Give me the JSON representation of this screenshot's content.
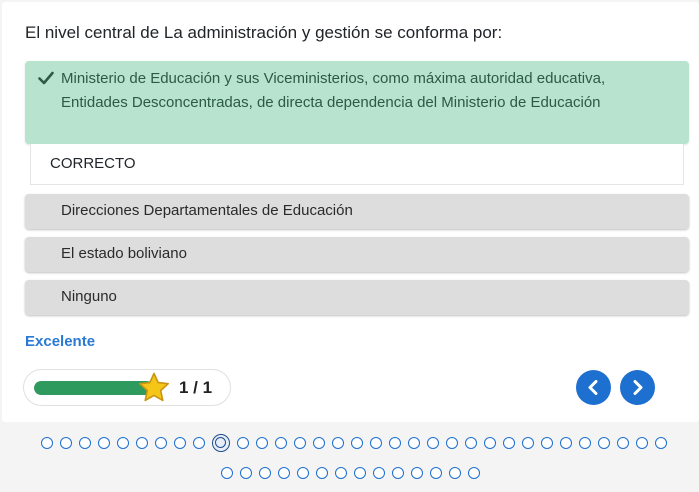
{
  "question": {
    "text": "El nivel central de La administración y gestión se conforma por:"
  },
  "answers": {
    "selected": "Ministerio de Educación y sus Viceministerios, como máxima autoridad educativa, Entidades Desconcentradas, de directa dependencia del Ministerio de Educación",
    "feedback": "CORRECTO",
    "options": [
      "Direcciones Departamentales de Educación",
      "El estado boliviano",
      "Ninguno"
    ]
  },
  "result": {
    "label": "Excelente"
  },
  "progress": {
    "count_label": "1 / 1",
    "fraction": 1.0
  },
  "pagination": {
    "row1_count": 33,
    "row2_count": 14,
    "current_index": 9
  },
  "colors": {
    "correct_bg": "#b8e4cf",
    "correct_text": "#2b5a45",
    "accent": "#1d6fd0",
    "result_text": "#2a7ad3",
    "progress_fill": "#2e9a5e",
    "star": "#f5c518"
  },
  "icons": {
    "check": "check-icon",
    "star": "star-icon",
    "prev": "chevron-left-icon",
    "next": "chevron-right-icon"
  }
}
